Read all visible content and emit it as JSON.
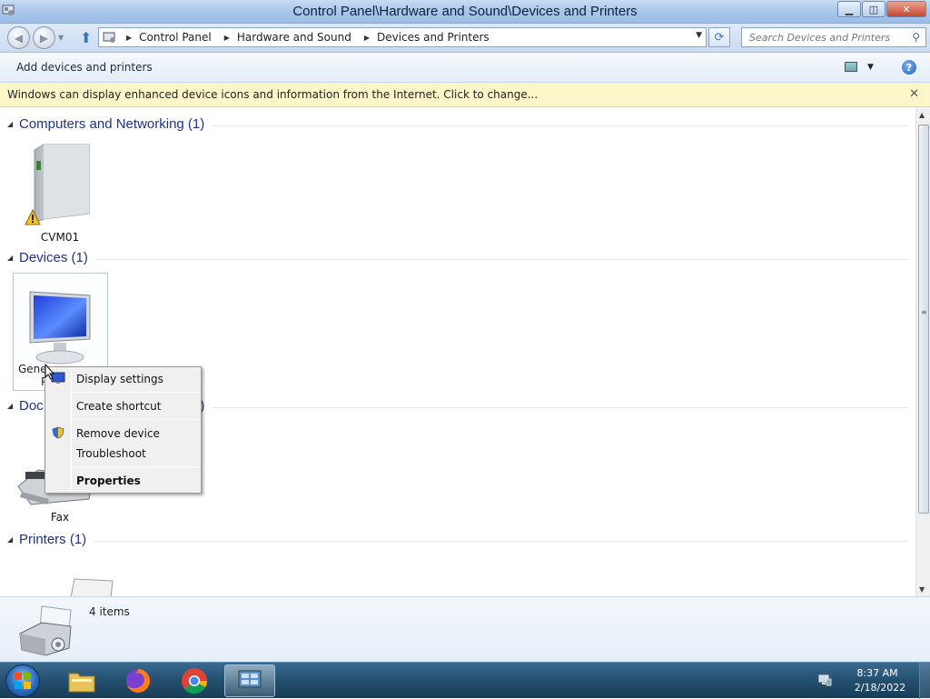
{
  "window": {
    "title": "Control Panel\\Hardware and Sound\\Devices and Printers",
    "minimize_glyph": "▁",
    "maximize_glyph": "◫",
    "close_glyph": "✕"
  },
  "nav": {
    "back_glyph": "◀",
    "forward_glyph": "▶",
    "breadcrumbs": [
      "Control Panel",
      "Hardware and Sound",
      "Devices and Printers"
    ],
    "search_placeholder": "Search Devices and Printers"
  },
  "commandbar": {
    "add_devices_label": "Add devices and printers",
    "help_glyph": "?"
  },
  "infobar": {
    "message": "Windows can display enhanced device icons and information from the Internet. Click to change...",
    "close_glyph": "✕"
  },
  "groups": [
    {
      "title": "Computers and Networking (1)"
    },
    {
      "title": "Devices (1)"
    },
    {
      "title": "Doc",
      "title_suffix": "1)"
    },
    {
      "title": "Printers (1)"
    }
  ],
  "items": {
    "computer_label": "CVM01",
    "monitor_label_visible": "Gene",
    "monitor_label_tail": "P",
    "fax_label": "Fax"
  },
  "context_menu": {
    "items": [
      "Display settings",
      "Create shortcut",
      "Remove device",
      "Troubleshoot",
      "Properties"
    ]
  },
  "statusbar": {
    "count": "4 items"
  },
  "taskbar": {
    "time": "8:37 AM",
    "date": "2/18/2022"
  },
  "colors": {
    "group_title": "#1e3287",
    "infobar_bg": "#fcf7c9",
    "taskbar_bg": "#24506f"
  }
}
